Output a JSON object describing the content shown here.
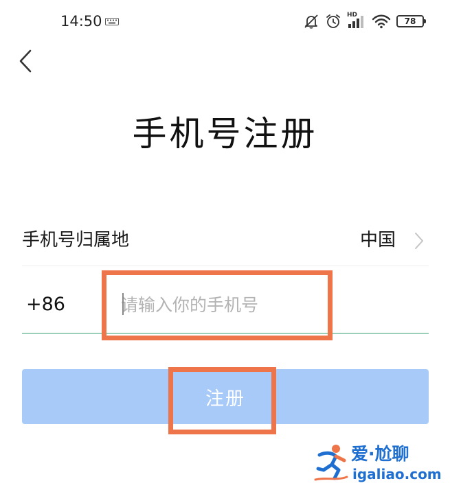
{
  "status_bar": {
    "time": "14:50",
    "network_label": "HD",
    "battery": "78"
  },
  "header": {
    "title": "手机号注册"
  },
  "region": {
    "label": "手机号归属地",
    "value": "中国"
  },
  "phone": {
    "country_code": "+86",
    "value": "",
    "placeholder": "请输入你的手机号"
  },
  "register_button": {
    "label": "注册"
  },
  "watermark": {
    "name": "爱·尬聊",
    "domain": "igaliao.com"
  },
  "colors": {
    "button_background": "#a8caf8",
    "input_underline": "#2f9c6f",
    "highlight": "#ee7449",
    "watermark_blue": "#1f6fd1"
  }
}
